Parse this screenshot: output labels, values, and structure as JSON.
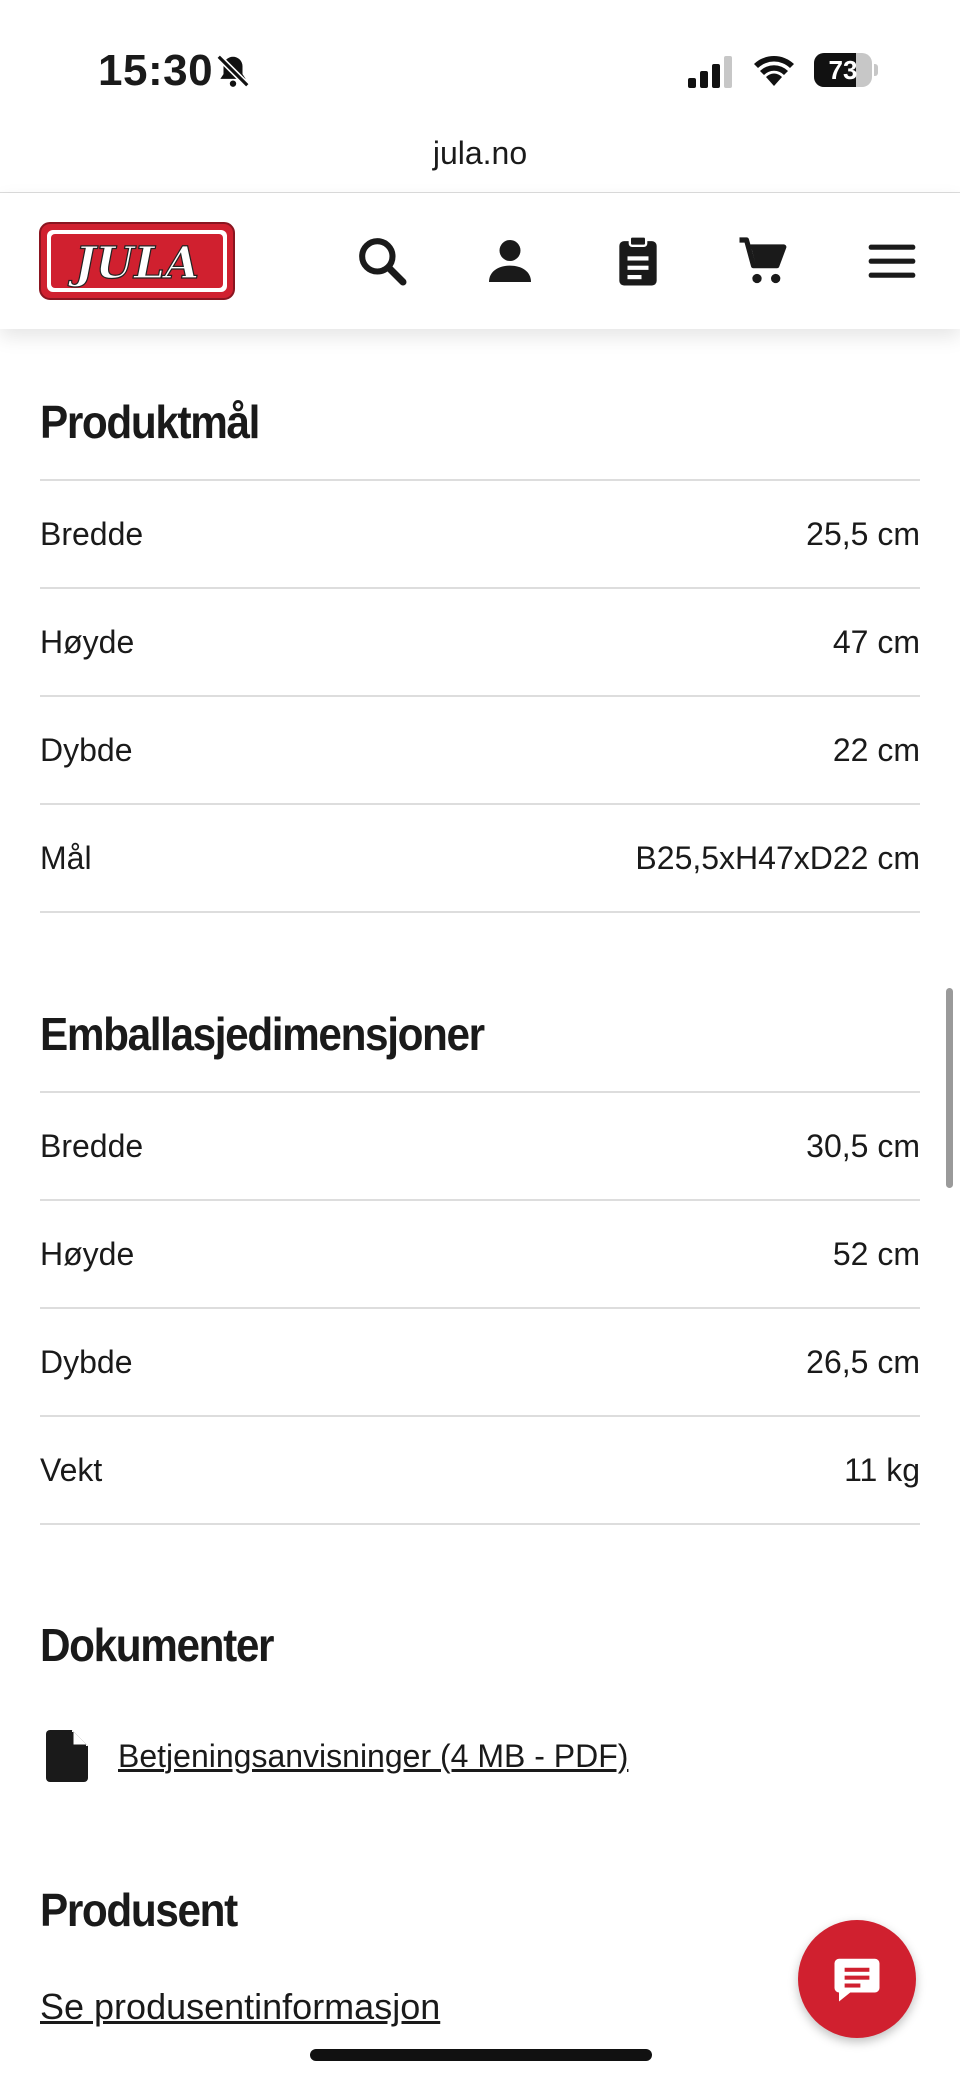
{
  "status_bar": {
    "time": "15:30",
    "battery": "73",
    "battery_level": 0.73
  },
  "browser": {
    "url": "jula.no"
  },
  "header": {
    "logo_text": "JULA"
  },
  "produktmal": {
    "title": "Produktmål",
    "rows": [
      {
        "label": "Bredde",
        "value": "25,5 cm"
      },
      {
        "label": "Høyde",
        "value": "47 cm"
      },
      {
        "label": "Dybde",
        "value": "22 cm"
      },
      {
        "label": "Mål",
        "value": "B25,5xH47xD22 cm"
      }
    ]
  },
  "emballasje": {
    "title": "Emballasjedimensjoner",
    "rows": [
      {
        "label": "Bredde",
        "value": "30,5 cm"
      },
      {
        "label": "Høyde",
        "value": "52 cm"
      },
      {
        "label": "Dybde",
        "value": "26,5 cm"
      },
      {
        "label": "Vekt",
        "value": "11 kg"
      }
    ]
  },
  "dokumenter": {
    "title": "Dokumenter",
    "link_label": "Betjeningsanvisninger (4 MB - PDF)"
  },
  "produsent": {
    "title": "Produsent",
    "link_label": "Se produsentinformasjon"
  },
  "colors": {
    "brand_red": "#d0202f"
  }
}
